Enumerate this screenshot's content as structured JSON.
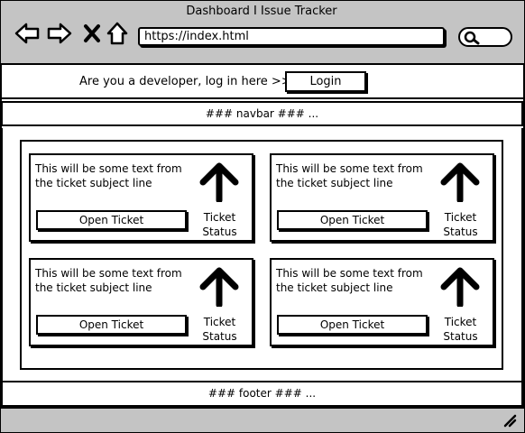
{
  "window": {
    "title": "Dashboard I Issue Tracker"
  },
  "browser": {
    "address": "https://index.html",
    "icons": [
      "back-arrow-icon",
      "forward-arrow-icon",
      "close-icon",
      "home-icon",
      "search-icon"
    ]
  },
  "login_bar": {
    "prompt": "Are you a developer, log in here >>",
    "button_label": "Login"
  },
  "navbar": {
    "text": "### navbar ###      ..."
  },
  "tickets": [
    {
      "subject": "This will be some text from the ticket subject line",
      "button_label": "Open Ticket",
      "status_label": "Ticket Status",
      "status_icon": "arrow-up-icon"
    },
    {
      "subject": "This will be some text from the ticket subject line",
      "button_label": "Open Ticket",
      "status_label": "Ticket Status",
      "status_icon": "arrow-up-icon"
    },
    {
      "subject": "This will be some text from the ticket subject line",
      "button_label": "Open Ticket",
      "status_label": "Ticket Status",
      "status_icon": "arrow-up-icon"
    },
    {
      "subject": "This will be some text from the ticket subject line",
      "button_label": "Open Ticket",
      "status_label": "Ticket Status",
      "status_icon": "arrow-up-icon"
    }
  ],
  "footer": {
    "text": "### footer ###      ..."
  },
  "colors": {
    "chrome": "#c4c4c4",
    "ink": "#000000",
    "background": "#ffffff"
  }
}
